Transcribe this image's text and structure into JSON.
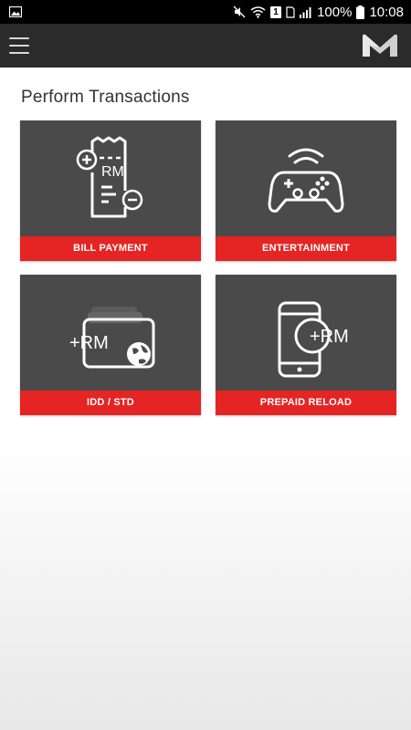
{
  "status_bar": {
    "battery_percent": "100%",
    "time": "10:08",
    "sim_badge": "1"
  },
  "app_bar": {
    "menu_icon": "hamburger-menu-icon",
    "logo_icon": "m-logo-icon"
  },
  "main": {
    "title": "Perform Transactions",
    "tiles": [
      {
        "label": "BILL PAYMENT",
        "icon": "bill-receipt-icon",
        "icon_text": "RM"
      },
      {
        "label": "ENTERTAINMENT",
        "icon": "gamepad-icon"
      },
      {
        "label": "IDD / STD",
        "icon": "cards-globe-icon",
        "icon_text": "+RM"
      },
      {
        "label": "PREPAID RELOAD",
        "icon": "phone-reload-icon",
        "icon_text": "+RM"
      }
    ]
  },
  "colors": {
    "tile_bg": "#4a4a4a",
    "tile_label_bg": "#e52424",
    "app_bar_bg": "#2b2b2b"
  }
}
